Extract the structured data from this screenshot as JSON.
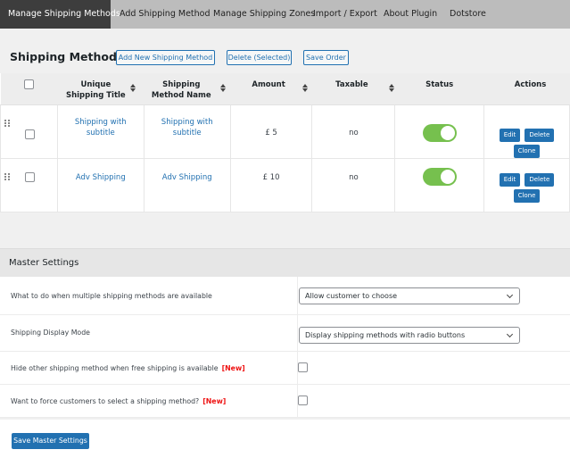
{
  "nav": {
    "tabs": [
      {
        "label": "Manage Shipping Methods",
        "active": true
      },
      {
        "label": "Add Shipping Method",
        "active": false
      },
      {
        "label": "Manage Shipping Zones",
        "active": false
      },
      {
        "label": "Import / Export",
        "active": false
      },
      {
        "label": "About Plugin",
        "active": false
      },
      {
        "label": "Dotstore",
        "active": false
      }
    ]
  },
  "shipping_methods": {
    "title": "Shipping Methods",
    "buttons": {
      "add": "Add New Shipping Method",
      "delete_selected": "Delete (Selected)",
      "save_order": "Save Order"
    },
    "columns": [
      {
        "label": "Unique Shipping Title",
        "sortable": true
      },
      {
        "label": "Shipping Method Name",
        "sortable": true
      },
      {
        "label": "Amount",
        "sortable": true
      },
      {
        "label": "Taxable",
        "sortable": true
      },
      {
        "label": "Status",
        "sortable": false
      },
      {
        "label": "Actions",
        "sortable": false
      }
    ],
    "rows": [
      {
        "unique_title": "Shipping with subtitle",
        "method_name": "Shipping with subtitle",
        "amount": "£ 5",
        "taxable": "no",
        "status_enabled": true,
        "checked": false
      },
      {
        "unique_title": "Adv Shipping",
        "method_name": "Adv Shipping",
        "amount": "£ 10",
        "taxable": "no",
        "status_enabled": true,
        "checked": false
      }
    ],
    "row_actions": {
      "edit": "Edit",
      "delete": "Delete",
      "clone": "Clone"
    }
  },
  "master_settings": {
    "title": "Master Settings",
    "rows": [
      {
        "label": "What to do when multiple shipping methods are available",
        "type": "select",
        "value": "Allow customer to choose"
      },
      {
        "label": "Shipping Display Mode",
        "type": "select",
        "value": "Display shipping methods with radio buttons"
      },
      {
        "label": "Hide other shipping method when free shipping is available",
        "badge": "[New]",
        "type": "checkbox",
        "checked": false
      },
      {
        "label": "Want to force customers to select a shipping method?",
        "badge": "[New]",
        "type": "checkbox",
        "checked": false
      }
    ],
    "save_label": "Save Master Settings"
  },
  "colors": {
    "accent": "#2271b1",
    "nav_active_bg": "#3d3d3d",
    "nav_bg": "#bcbcbc",
    "toggle_on": "#76c04e",
    "new_badge": "#ee1111"
  }
}
